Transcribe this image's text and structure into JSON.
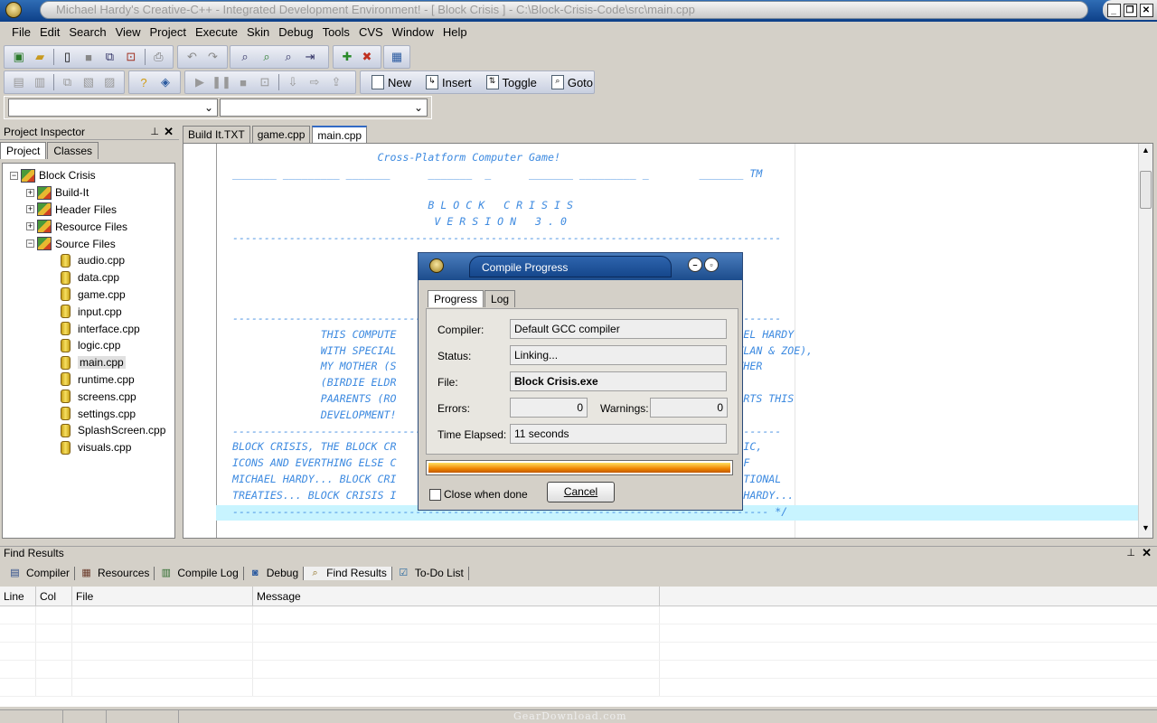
{
  "window": {
    "title": "Michael Hardy's Creative-C++ - Integrated Development Environment!  - [ Block Crisis ] - C:\\Block-Crisis-Code\\src\\main.cpp"
  },
  "menu": [
    "File",
    "Edit",
    "Search",
    "View",
    "Project",
    "Execute",
    "Skin",
    "Debug",
    "Tools",
    "CVS",
    "Window",
    "Help"
  ],
  "bookmark_toolbar": {
    "new_label": "New",
    "insert_label": "Insert",
    "toggle_label": "Toggle",
    "goto_label": "Goto"
  },
  "inspector": {
    "title": "Project Inspector",
    "tabs": [
      "Project",
      "Classes"
    ],
    "project_name": "Block Crisis",
    "folders": [
      "Build-It",
      "Header Files",
      "Resource Files",
      "Source Files"
    ],
    "files": [
      "audio.cpp",
      "data.cpp",
      "game.cpp",
      "input.cpp",
      "interface.cpp",
      "logic.cpp",
      "main.cpp",
      "runtime.cpp",
      "screens.cpp",
      "settings.cpp",
      "SplashScreen.cpp",
      "visuals.cpp"
    ],
    "selected_file": "main.cpp"
  },
  "editor": {
    "tabs": [
      "Build It.TXT",
      "game.cpp",
      "main.cpp"
    ],
    "active_tab": "main.cpp",
    "lines": [
      "                       Cross-Platform Computer Game!",
      "_______ _________ _______      _______  _      _______ _________ _        _______ TM",
      "",
      "                               B L O C K   C R I S I S",
      "                                V E R S I O N   3 . 0",
      "---------------------------------------------------------------------------------------",
      "",
      "",
      "",
      "",
      "---------------------------------------------------------------------------------------",
      "              THIS COMPUTE                                         LOVED BY MICHAEL HARDY",
      "              WITH SPECIAL                                         S CHILDREN (DYLAN & ZOE),",
      "              MY MOTHER (S                                         ), MY GRANDMOTHER",
      "              (BIRDIE ELDR                                         OR), MY WIFE'S",
      "              PAARENTS (RO                                         D HARRY) SUPPORTS THIS",
      "              DEVELOPMENT!",
      "---------------------------------------------------------------------------------------",
      "BLOCK CRISIS, THE BLOCK CR                                         S, SOUNDS, MUSIC,",
      "ICONS AND EVERTHING ELSE C                                         D TRADEMARKS OF",
      "MICHAEL HARDY... BLOCK CRI                                         TED BY INTERNATIONAL",
      "TREATIES... BLOCK CRISIS I                                         ED BY MICHAEL HARDY...",
      "------------------------------------------------------------------------------------- */"
    ]
  },
  "dialog": {
    "title": "Compile Progress",
    "tabs": [
      "Progress",
      "Log"
    ],
    "compiler_label": "Compiler:",
    "compiler_value": "Default GCC compiler",
    "status_label": "Status:",
    "status_value": "Linking...",
    "file_label": "File:",
    "file_value": "Block Crisis.exe",
    "errors_label": "Errors:",
    "errors_value": "0",
    "warnings_label": "Warnings:",
    "warnings_value": "0",
    "time_label": "Time Elapsed:",
    "time_value": "11 seconds",
    "progress_fraction": 1.0,
    "close_when_done_label": "Close when done",
    "cancel_label": "Cancel"
  },
  "find_panel": {
    "title": "Find Results",
    "tabs": [
      {
        "label": "Compiler",
        "icon": "compiler-icon"
      },
      {
        "label": "Resources",
        "icon": "resources-icon"
      },
      {
        "label": "Compile Log",
        "icon": "chart-icon"
      },
      {
        "label": "Debug",
        "icon": "debug-icon"
      },
      {
        "label": "Find Results",
        "icon": "search-icon"
      },
      {
        "label": "To-Do List",
        "icon": "todo-icon"
      }
    ],
    "active_tab": "Find Results",
    "columns": [
      "Line",
      "Col",
      "File",
      "Message"
    ]
  },
  "watermark": "GearDownload.com"
}
